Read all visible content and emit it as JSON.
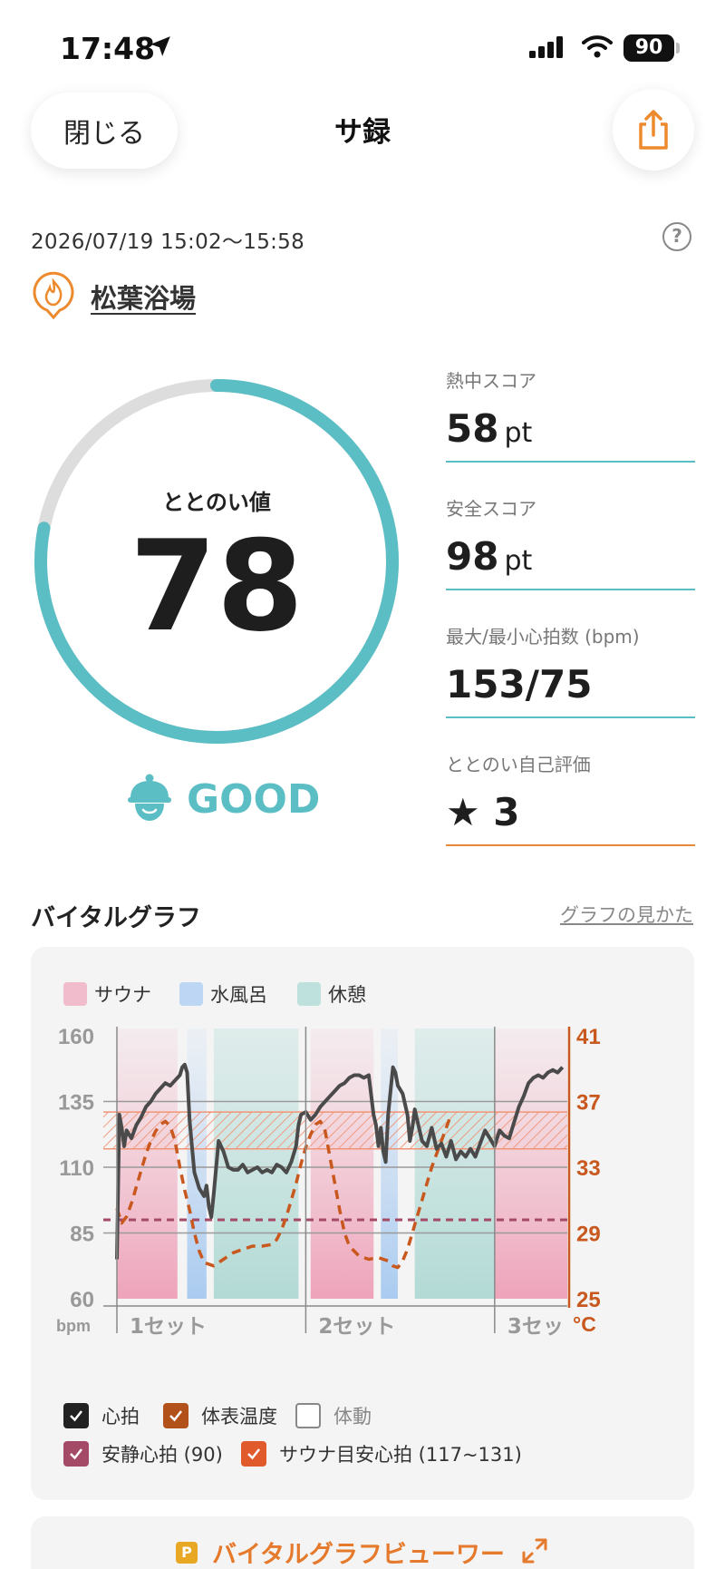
{
  "status_bar": {
    "time": "17:48",
    "battery": "90"
  },
  "nav": {
    "close_label": "閉じる",
    "title": "サ録"
  },
  "session": {
    "datetime": "2026/07/19 15:02〜15:58",
    "facility": "松葉浴場"
  },
  "gauge": {
    "label": "ととのい値",
    "value": "78",
    "progress": 0.78,
    "rating": "GOOD",
    "color": "#5bbec4"
  },
  "stats": [
    {
      "label": "熱中スコア",
      "value": "58",
      "unit": "pt"
    },
    {
      "label": "安全スコア",
      "value": "98",
      "unit": "pt"
    },
    {
      "label": "最大/最小心拍数 (bpm)",
      "value": "153/75",
      "unit": ""
    },
    {
      "label": "ととのい自己評価",
      "value": "★ 3",
      "unit": ""
    }
  ],
  "vital_section": {
    "title": "バイタルグラフ",
    "guide_link": "グラフの見かた"
  },
  "legend": [
    {
      "label": "サウナ",
      "color": "#f1bccb"
    },
    {
      "label": "水風呂",
      "color": "#bcd6f3"
    },
    {
      "label": "休憩",
      "color": "#bfe1dd"
    }
  ],
  "chart_data": {
    "type": "line",
    "yleft": {
      "label": "bpm",
      "ticks": [
        "160",
        "135",
        "110",
        "85",
        "60"
      ],
      "range": [
        60,
        160
      ]
    },
    "yright": {
      "label": "°C",
      "ticks": [
        "41",
        "37",
        "33",
        "29",
        "25"
      ],
      "range": [
        25,
        41
      ]
    },
    "x_sets": [
      "1セット",
      "2セット",
      "3セッ"
    ],
    "zones": [
      {
        "type": "sauna",
        "start": 0,
        "end": 12.5
      },
      {
        "type": "cold",
        "start": 14.5,
        "end": 18.5
      },
      {
        "type": "rest",
        "start": 20,
        "end": 37.5
      },
      {
        "type": "sauna",
        "start": 40,
        "end": 53
      },
      {
        "type": "cold",
        "start": 54.5,
        "end": 58
      },
      {
        "type": "rest",
        "start": 61.5,
        "end": 78
      },
      {
        "type": "sauna",
        "start": 78,
        "end": 93
      }
    ],
    "set_marks": [
      0,
      39,
      78
    ],
    "x_range": [
      0,
      93
    ],
    "resting_hr": 90,
    "target_band": [
      117,
      131
    ],
    "series": [
      {
        "name": "心拍",
        "color": "#4a4a4a",
        "points": [
          [
            0,
            75
          ],
          [
            0.5,
            130
          ],
          [
            1,
            125
          ],
          [
            1.5,
            118
          ],
          [
            2,
            124
          ],
          [
            3,
            121
          ],
          [
            4,
            126
          ],
          [
            5,
            129
          ],
          [
            6,
            133
          ],
          [
            7,
            135
          ],
          [
            8,
            138
          ],
          [
            9,
            140
          ],
          [
            10,
            142
          ],
          [
            11,
            141
          ],
          [
            12,
            143
          ],
          [
            13,
            145
          ],
          [
            13.5,
            148
          ],
          [
            14,
            149
          ],
          [
            14.5,
            146
          ],
          [
            15,
            128
          ],
          [
            15.5,
            118
          ],
          [
            16,
            108
          ],
          [
            17,
            102
          ],
          [
            18,
            99
          ],
          [
            18.5,
            103
          ],
          [
            19,
            95
          ],
          [
            19.5,
            91
          ],
          [
            20,
            100
          ],
          [
            21,
            120
          ],
          [
            22,
            116
          ],
          [
            23,
            110
          ],
          [
            24,
            109
          ],
          [
            25,
            109
          ],
          [
            26,
            111
          ],
          [
            27,
            108
          ],
          [
            28,
            109
          ],
          [
            29,
            110
          ],
          [
            30,
            108
          ],
          [
            31,
            109
          ],
          [
            32,
            108
          ],
          [
            33,
            111
          ],
          [
            34,
            110
          ],
          [
            35,
            108
          ],
          [
            36,
            112
          ],
          [
            37,
            118
          ],
          [
            37.5,
            126
          ],
          [
            38,
            130
          ],
          [
            39,
            131
          ],
          [
            40,
            128
          ],
          [
            41,
            130
          ],
          [
            42,
            133
          ],
          [
            43,
            135
          ],
          [
            44,
            137
          ],
          [
            45,
            139
          ],
          [
            46,
            141
          ],
          [
            47,
            142
          ],
          [
            48,
            144
          ],
          [
            49,
            145
          ],
          [
            50,
            145
          ],
          [
            51,
            144
          ],
          [
            52,
            145
          ],
          [
            53,
            130
          ],
          [
            53.5,
            126
          ],
          [
            54,
            118
          ],
          [
            54.5,
            125
          ],
          [
            55,
            116
          ],
          [
            55.5,
            112
          ],
          [
            56,
            130
          ],
          [
            57,
            148
          ],
          [
            57.5,
            146
          ],
          [
            58,
            141
          ],
          [
            59,
            138
          ],
          [
            60,
            130
          ],
          [
            60.5,
            120
          ],
          [
            61,
            125
          ],
          [
            61.5,
            132
          ],
          [
            62,
            128
          ],
          [
            63,
            120
          ],
          [
            64,
            118
          ],
          [
            65,
            125
          ],
          [
            66,
            117
          ],
          [
            67,
            119
          ],
          [
            68,
            114
          ],
          [
            69,
            120
          ],
          [
            70,
            113
          ],
          [
            71,
            116
          ],
          [
            72,
            114
          ],
          [
            73,
            117
          ],
          [
            74,
            114
          ],
          [
            75,
            119
          ],
          [
            76,
            124
          ],
          [
            77,
            121
          ],
          [
            78,
            118
          ],
          [
            79,
            124
          ],
          [
            80,
            122
          ],
          [
            81,
            121
          ],
          [
            82,
            127
          ],
          [
            83,
            133
          ],
          [
            84,
            137
          ],
          [
            85,
            142
          ],
          [
            86,
            144
          ],
          [
            87,
            145
          ],
          [
            88,
            144
          ],
          [
            89,
            146
          ],
          [
            90,
            147
          ],
          [
            91,
            146
          ],
          [
            92,
            148
          ]
        ]
      },
      {
        "name": "体表温度",
        "color": "#c8581e",
        "points": [
          [
            0,
            30.5
          ],
          [
            1,
            29.6
          ],
          [
            2,
            30.0
          ],
          [
            3,
            30.8
          ],
          [
            4,
            31.8
          ],
          [
            5,
            32.8
          ],
          [
            6,
            33.8
          ],
          [
            7,
            34.6
          ],
          [
            8,
            35.2
          ],
          [
            9,
            35.6
          ],
          [
            10,
            35.8
          ],
          [
            11,
            35.5
          ],
          [
            12,
            34.6
          ],
          [
            13,
            33.0
          ],
          [
            14,
            31.6
          ],
          [
            15,
            30.4
          ],
          [
            16,
            29.0
          ],
          [
            17,
            27.9
          ],
          [
            18,
            27.2
          ],
          [
            20,
            27.0
          ],
          [
            22,
            27.4
          ],
          [
            24,
            27.8
          ],
          [
            26,
            28.0
          ],
          [
            28,
            28.2
          ],
          [
            30,
            28.2
          ],
          [
            32,
            28.3
          ],
          [
            33,
            28.6
          ],
          [
            34,
            29.2
          ],
          [
            35,
            30.0
          ],
          [
            36,
            31.0
          ],
          [
            37,
            32.0
          ],
          [
            38,
            33.2
          ],
          [
            39,
            34.2
          ],
          [
            40,
            35.0
          ],
          [
            41,
            35.6
          ],
          [
            42,
            35.8
          ],
          [
            43,
            35.2
          ],
          [
            44,
            33.6
          ],
          [
            45,
            32.0
          ],
          [
            46,
            30.4
          ],
          [
            47,
            29.0
          ],
          [
            48,
            28.2
          ],
          [
            50,
            27.6
          ],
          [
            52,
            27.4
          ],
          [
            54,
            27.5
          ],
          [
            56,
            27.3
          ],
          [
            57,
            27.0
          ],
          [
            58,
            26.9
          ],
          [
            59,
            27.3
          ],
          [
            60,
            28.0
          ],
          [
            61,
            29.0
          ],
          [
            62,
            30.0
          ],
          [
            63,
            31.0
          ],
          [
            64,
            32.0
          ],
          [
            65,
            33.0
          ],
          [
            66,
            33.8
          ],
          [
            67,
            34.6
          ],
          [
            68,
            35.4
          ],
          [
            69,
            36.2
          ]
        ]
      }
    ]
  },
  "checks": [
    {
      "label": "心拍",
      "checked": true,
      "color": "#222222"
    },
    {
      "label": "体表温度",
      "checked": true,
      "color": "#b2521a"
    },
    {
      "label": "体動",
      "checked": false,
      "color": "#888888"
    },
    {
      "label": "安静心拍 (90)",
      "checked": true,
      "color": "#a54a66"
    },
    {
      "label": "サウナ目安心拍 (117~131)",
      "checked": true,
      "color": "#e15a2c"
    }
  ],
  "viewer": {
    "label": "バイタルグラフビューワー"
  }
}
